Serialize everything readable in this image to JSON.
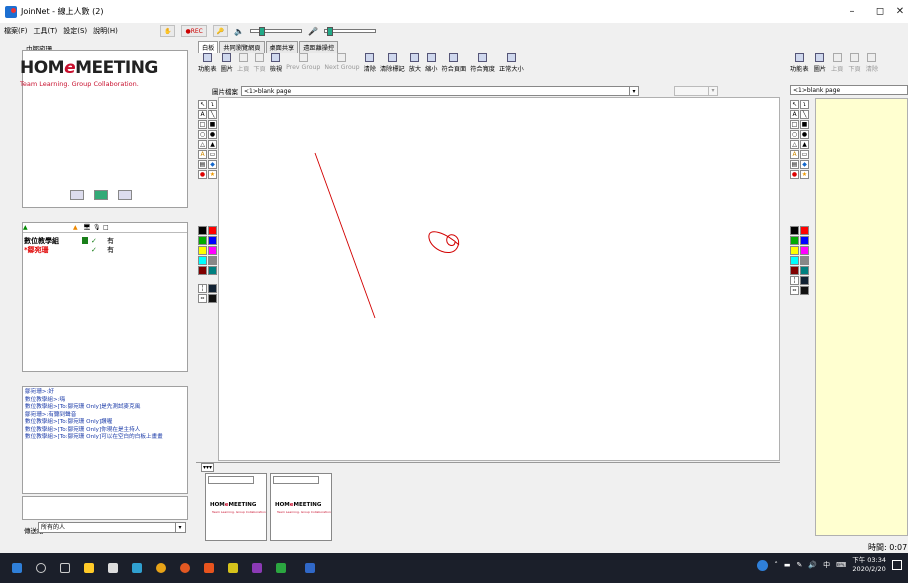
{
  "window": {
    "title": "JoinNet - 線上人數 (2)",
    "min": "–",
    "max": "◻",
    "close": "✕"
  },
  "menu": [
    "檔案(F)",
    "工具(T)",
    "設定(S)",
    "說明(H)"
  ],
  "toolbar": {
    "rec_label": "●REC"
  },
  "left": {
    "panel_label": "巾鄒宛珊",
    "logo_brand_left": "HOM",
    "logo_brand_e": "e",
    "logo_brand_right": "MEETING",
    "logo_tagline": "Team Learning. Group Collaboration.",
    "user_list_head": [
      "▲",
      "",
      "",
      "",
      "",
      "□"
    ],
    "users": [
      {
        "name": "數位教學組",
        "status": "有",
        "color": "#000"
      },
      {
        "name": "*鄒宛珊",
        "status": "有",
        "color": "#e00000"
      }
    ],
    "chat": [
      "鄒宛珊>:好",
      "數位教學組>:嗨",
      "數位教學組>[To:鄒宛珊 Only]是先測試麥克風",
      "鄒宛珊>:有聽到聲音",
      "數位教學組>[To:鄒宛珊 Only]讚喔",
      "數位教學組>[To:鄒宛珊 Only]你現在是主持人",
      "數位教學組>[To:鄒宛珊 Only]可以在空白的白板上畫畫"
    ],
    "send_to_label": "傳送給",
    "send_to_value": "所有的人"
  },
  "tabs": [
    "白板",
    "共同瀏覽網頁",
    "桌面共享",
    "遠距離操控"
  ],
  "ribbon": [
    {
      "label": "功能表",
      "disabled": false
    },
    {
      "label": "圖片",
      "disabled": false
    },
    {
      "label": "上頁",
      "disabled": true
    },
    {
      "label": "下頁",
      "disabled": true
    },
    {
      "label": "檢視",
      "disabled": false
    },
    {
      "label": "Prev Group",
      "disabled": true
    },
    {
      "label": "Next Group",
      "disabled": true
    },
    {
      "label": "清除",
      "disabled": false
    },
    {
      "label": "清除標記",
      "disabled": false
    },
    {
      "label": "放大",
      "disabled": false
    },
    {
      "label": "縮小",
      "disabled": false
    },
    {
      "label": "符合頁面",
      "disabled": false
    },
    {
      "label": "符合寬度",
      "disabled": false
    },
    {
      "label": "正常大小",
      "disabled": false
    }
  ],
  "file": {
    "label": "圖片檔案",
    "value": "<1>blank page"
  },
  "right": {
    "ribbon": [
      "功能表",
      "圖片",
      "上頁",
      "下頁",
      "清除"
    ],
    "page_value": "<1>blank page",
    "timer": "時間: 0:07"
  },
  "thumbs": [
    {
      "brand_left": "HOM",
      "brand_e": "e",
      "brand_right": "MEETING",
      "tag": "Team Learning. Group Collaboration"
    },
    {
      "brand_left": "HOM",
      "brand_e": "e",
      "brand_right": "MEETING",
      "tag": "Team Learning. Group Collaboration"
    }
  ],
  "thumb_toggle": "▾▾▾",
  "palette_colors": [
    "#000000",
    "#ff0000",
    "#00aa00",
    "#0000ff",
    "#ffff00",
    "#ff00ff",
    "#00ffff",
    "#888888",
    "#800000",
    "#008080"
  ],
  "taskbar": {
    "clock_time": "下午 03:34",
    "clock_date": "2020/2/20",
    "ime": "中"
  }
}
